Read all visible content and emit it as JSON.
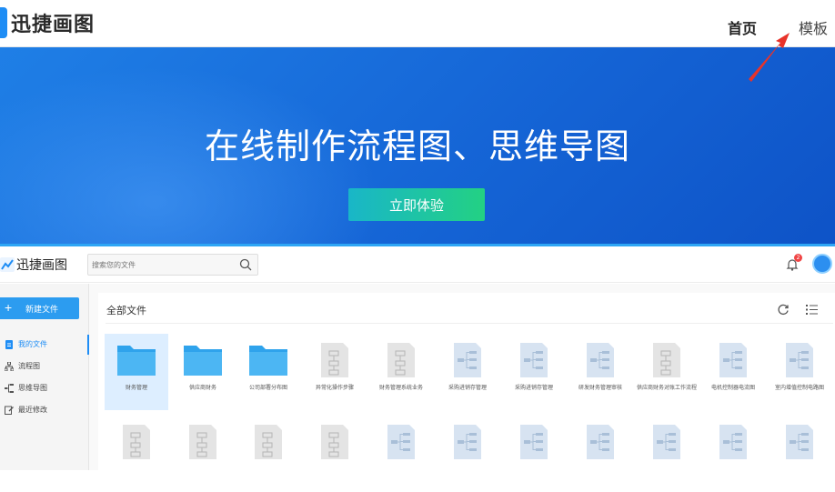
{
  "top_nav": {
    "brand": "迅捷画图",
    "home": "首页",
    "templates": "模板"
  },
  "hero": {
    "title": "在线制作流程图、思维导图",
    "cta": "立即体验"
  },
  "app": {
    "brand": "迅捷画图",
    "search_placeholder": "搜索您的文件",
    "notification_count": "2",
    "new_file": "新建文件",
    "sidebar": [
      {
        "label": "我的文件",
        "icon": "document-icon",
        "active": true
      },
      {
        "label": "流程图",
        "icon": "flowchart-icon",
        "active": false
      },
      {
        "label": "思维导图",
        "icon": "mindmap-icon",
        "active": false
      },
      {
        "label": "最近修改",
        "icon": "recent-edit-icon",
        "active": false
      }
    ],
    "panel_title": "全部文件",
    "files_row1": [
      {
        "name": "财务管理",
        "kind": "folder",
        "selected": true
      },
      {
        "name": "供应商财务",
        "kind": "folder"
      },
      {
        "name": "公司部署分布图",
        "kind": "folder"
      },
      {
        "name": "异常化操作步骤",
        "kind": "flowchart"
      },
      {
        "name": "财务管理系统业务",
        "kind": "flowchart"
      },
      {
        "name": "采购进销存管理",
        "kind": "mindmap"
      },
      {
        "name": "采购进销存管理",
        "kind": "mindmap"
      },
      {
        "name": "研发财务管理审核",
        "kind": "mindmap"
      },
      {
        "name": "供应商财务对账工作流程",
        "kind": "flowchart"
      },
      {
        "name": "电机控制器电流图",
        "kind": "mindmap"
      },
      {
        "name": "室内增值控制电路图",
        "kind": "mindmap"
      }
    ],
    "files_row2_kinds": [
      "flowchart",
      "flowchart",
      "flowchart",
      "flowchart",
      "mindmap",
      "mindmap",
      "mindmap",
      "mindmap",
      "mindmap",
      "mindmap",
      "mindmap"
    ]
  },
  "colors": {
    "brand_blue": "#1e8df5",
    "hero_blue": "#1565d6",
    "cta_start": "#19b6c8",
    "cta_end": "#23d183",
    "annotation_arrow": "#e8332a"
  }
}
